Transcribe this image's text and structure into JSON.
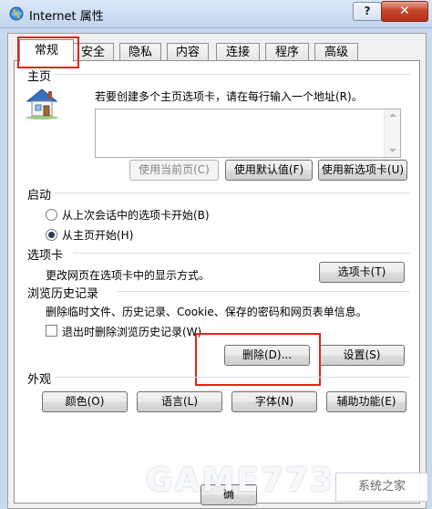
{
  "window": {
    "title": "Internet 属性",
    "help_label": "?",
    "close_label": "✕"
  },
  "tabs": [
    {
      "label": "常规",
      "active": true
    },
    {
      "label": "安全"
    },
    {
      "label": "隐私"
    },
    {
      "label": "内容"
    },
    {
      "label": "连接"
    },
    {
      "label": "程序"
    },
    {
      "label": "高级"
    }
  ],
  "home": {
    "group_title": "主页",
    "description": "若要创建多个主页选项卡，请在每行输入一个地址(R)。",
    "address_value": "",
    "use_current": "使用当前页(C)",
    "use_default": "使用默认值(F)",
    "use_new_tab": "使用新选项卡(U)"
  },
  "startup": {
    "group_title": "启动",
    "option_last_session": "从上次会话中的选项卡开始(B)",
    "option_home": "从主页开始(H)",
    "selected": "option_home"
  },
  "tabs_group": {
    "group_title": "选项卡",
    "description": "更改网页在选项卡中的显示方式。",
    "button": "选项卡(T)"
  },
  "history": {
    "group_title": "浏览历史记录",
    "description": "删除临时文件、历史记录、Cookie、保存的密码和网页表单信息。",
    "checkbox_label": "退出时删除浏览历史记录(W)",
    "checkbox_checked": false,
    "delete_button": "删除(D)...",
    "settings_button": "设置(S)"
  },
  "appearance": {
    "group_title": "外观",
    "colors": "颜色(O)",
    "languages": "语言(L)",
    "fonts": "字体(N)",
    "accessibility": "辅助功能(E)"
  },
  "bottom": {
    "ok_partial": "确"
  },
  "watermark": {
    "text": "GAME773",
    "badge": "系统之家"
  },
  "colors": {
    "highlight_red": "#e0241c",
    "title_bg": "#c9d9ee"
  }
}
